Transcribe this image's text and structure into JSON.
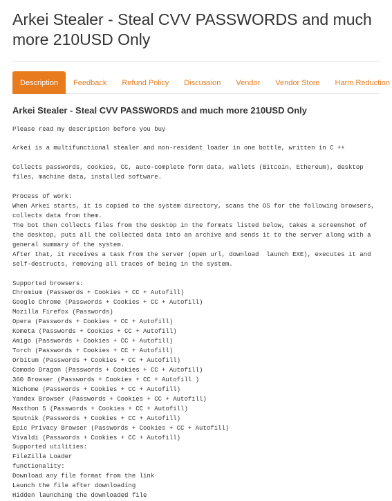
{
  "title": "Arkei Stealer - Steal CVV PASSWORDS and much more 210USD Only",
  "tabs": [
    {
      "label": "Description",
      "active": true
    },
    {
      "label": "Feedback",
      "active": false
    },
    {
      "label": "Refund Policy",
      "active": false
    },
    {
      "label": "Discussion",
      "active": false
    },
    {
      "label": "Vendor",
      "active": false
    },
    {
      "label": "Vendor Store",
      "active": false
    },
    {
      "label": "Harm Reduction Reviews",
      "active": false
    }
  ],
  "subheading": "Arkei Stealer - Steal CVV PASSWORDS and much more 210USD Only",
  "body": "Please read my description before you buy\n\nArkei is a multifunctional stealer and non-resident loader in one bottle, written in C ++\n\nCollects passwords, cookies, CC, auto-complete form data, wallets (Bitcoin, Ethereum), desktop files, machine data, installed software.\n\nProcess of work:\nWhen Arkei starts, it is copied to the system directory, scans the OS for the following browsers, collects data from them.\nThe bot then collects files from the desktop in the formats listed below, takes a screenshot of the desktop, puts all the collected data into an archive and sends it to the server along with a general summary of the system.\nAfter that, it receives a task from the server (open url, download  launch EXE), executes it and self-destructs, removing all traces of being in the system.\n\nSupported browsers:\nChromium (Passwords + Cookies + CC + Autofill)\nGoogle Chrome (Passwords + Cookies + CC + Autofill)\nMozilla Firefox (Passwords)\nOpera (Passwords + Cookies + CC + Autofill)\nKometa (Passwords + Cookies + CC + Autofill)\nAmigo (Passwords + Cookies + CC + Autofill)\nTorch (Passwords + Cookies + CC + Autofill)\nOrbitum (Passwords + Cookies + CC + Autofill)\nComodo Dragon (Passwords + Cookies + CC + Autofill)\n360 Browser (Passwords + Cookies + CC + Autofill )\nNichome (Passwords + Cookies + CC + Autofill)\nYandex Browser (Passwords + Cookies + CC + Autofill)\nMaxthon 5 (Passwords + Cookies + CC + Autofill)\nSputnik (Passwords + Cookies + CC + Autofill)\nEpic Privacy Browser (Passwords + Cookies + CC + Autofill)\nVivaldi (Passwords + Cookies + CC + Autofill)\nSupported utilities:\nFileZilla Loader\nfunctionality:\nDownload any file format from the link\nLaunch the file after downloading\nHidden launching the downloaded file"
}
